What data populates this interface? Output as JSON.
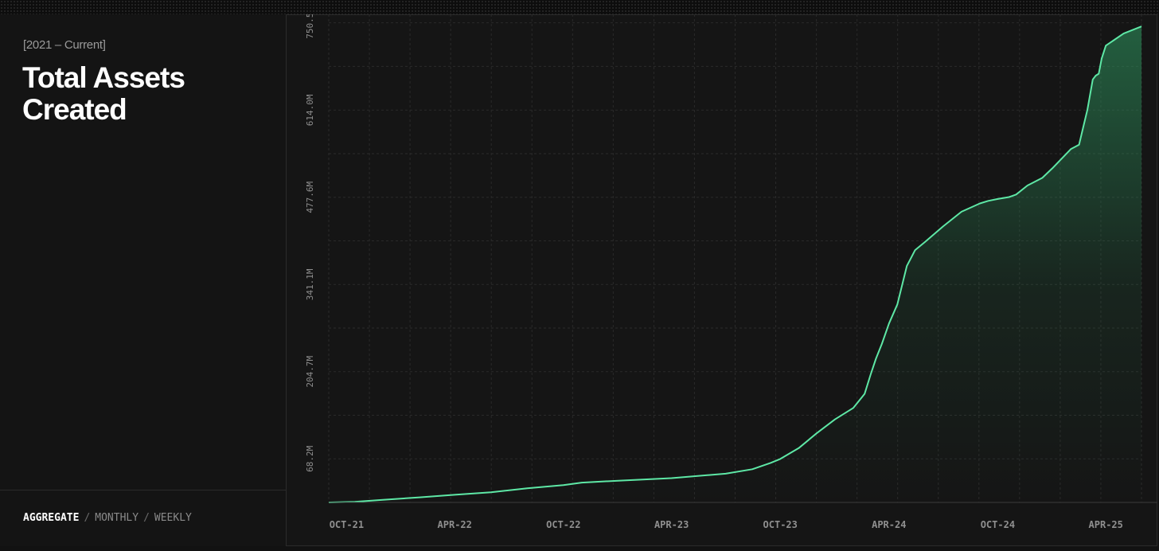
{
  "sidebar": {
    "range_label": "[2021 – Current]",
    "title": "Total Assets Created",
    "modes": [
      {
        "label": "AGGREGATE",
        "active": true
      },
      {
        "label": "MONTHLY",
        "active": false
      },
      {
        "label": "WEEKLY",
        "active": false
      }
    ],
    "separator": "/"
  },
  "colors": {
    "background": "#151515",
    "line": "#5ee8a6",
    "fill": "#2f9b62",
    "grid": "#2a2a2a",
    "tick_text": "#8f8f8f"
  },
  "chart_data": {
    "type": "area",
    "title": "Total Assets Created",
    "xlabel": "",
    "ylabel": "",
    "x_ticks": [
      "OCT-21",
      "APR-22",
      "OCT-22",
      "APR-23",
      "OCT-23",
      "APR-24",
      "OCT-24",
      "APR-25"
    ],
    "y_ticks": [
      "68.2M",
      "204.7M",
      "341.1M",
      "477.6M",
      "614.0M",
      "750.5M"
    ],
    "ylim": [
      0,
      764
    ],
    "xlim": [
      "2021-09-01",
      "2025-05-31"
    ],
    "grid": true,
    "series": [
      {
        "name": "",
        "x": [
          "2021-09-01",
          "2021-10-15",
          "2021-12-01",
          "2022-02-01",
          "2022-04-01",
          "2022-06-01",
          "2022-08-01",
          "2022-10-01",
          "2022-11-01",
          "2023-01-01",
          "2023-04-01",
          "2023-07-01",
          "2023-08-15",
          "2023-09-15",
          "2023-10-01",
          "2023-11-01",
          "2023-12-01",
          "2024-01-01",
          "2024-02-01",
          "2024-02-20",
          "2024-03-01",
          "2024-03-10",
          "2024-03-20",
          "2024-04-01",
          "2024-04-15",
          "2024-05-01",
          "2024-05-15",
          "2024-06-01",
          "2024-07-01",
          "2024-08-01",
          "2024-09-01",
          "2024-09-15",
          "2024-10-01",
          "2024-10-20",
          "2024-11-01",
          "2024-11-20",
          "2024-12-15",
          "2025-01-01",
          "2025-02-01",
          "2025-02-15",
          "2025-02-20",
          "2025-03-01",
          "2025-03-10",
          "2025-03-15",
          "2025-03-20",
          "2025-03-25",
          "2025-04-01",
          "2025-05-01",
          "2025-05-31"
        ],
        "values": [
          0,
          1,
          4,
          8,
          12,
          16,
          22,
          27,
          31,
          34,
          38,
          45,
          52,
          62,
          68,
          85,
          108,
          130,
          148,
          170,
          200,
          225,
          248,
          280,
          310,
          370,
          395,
          408,
          432,
          455,
          468,
          472,
          475,
          478,
          482,
          496,
          508,
          523,
          553,
          560,
          580,
          615,
          662,
          668,
          671,
          695,
          715,
          734,
          745
        ]
      }
    ]
  }
}
